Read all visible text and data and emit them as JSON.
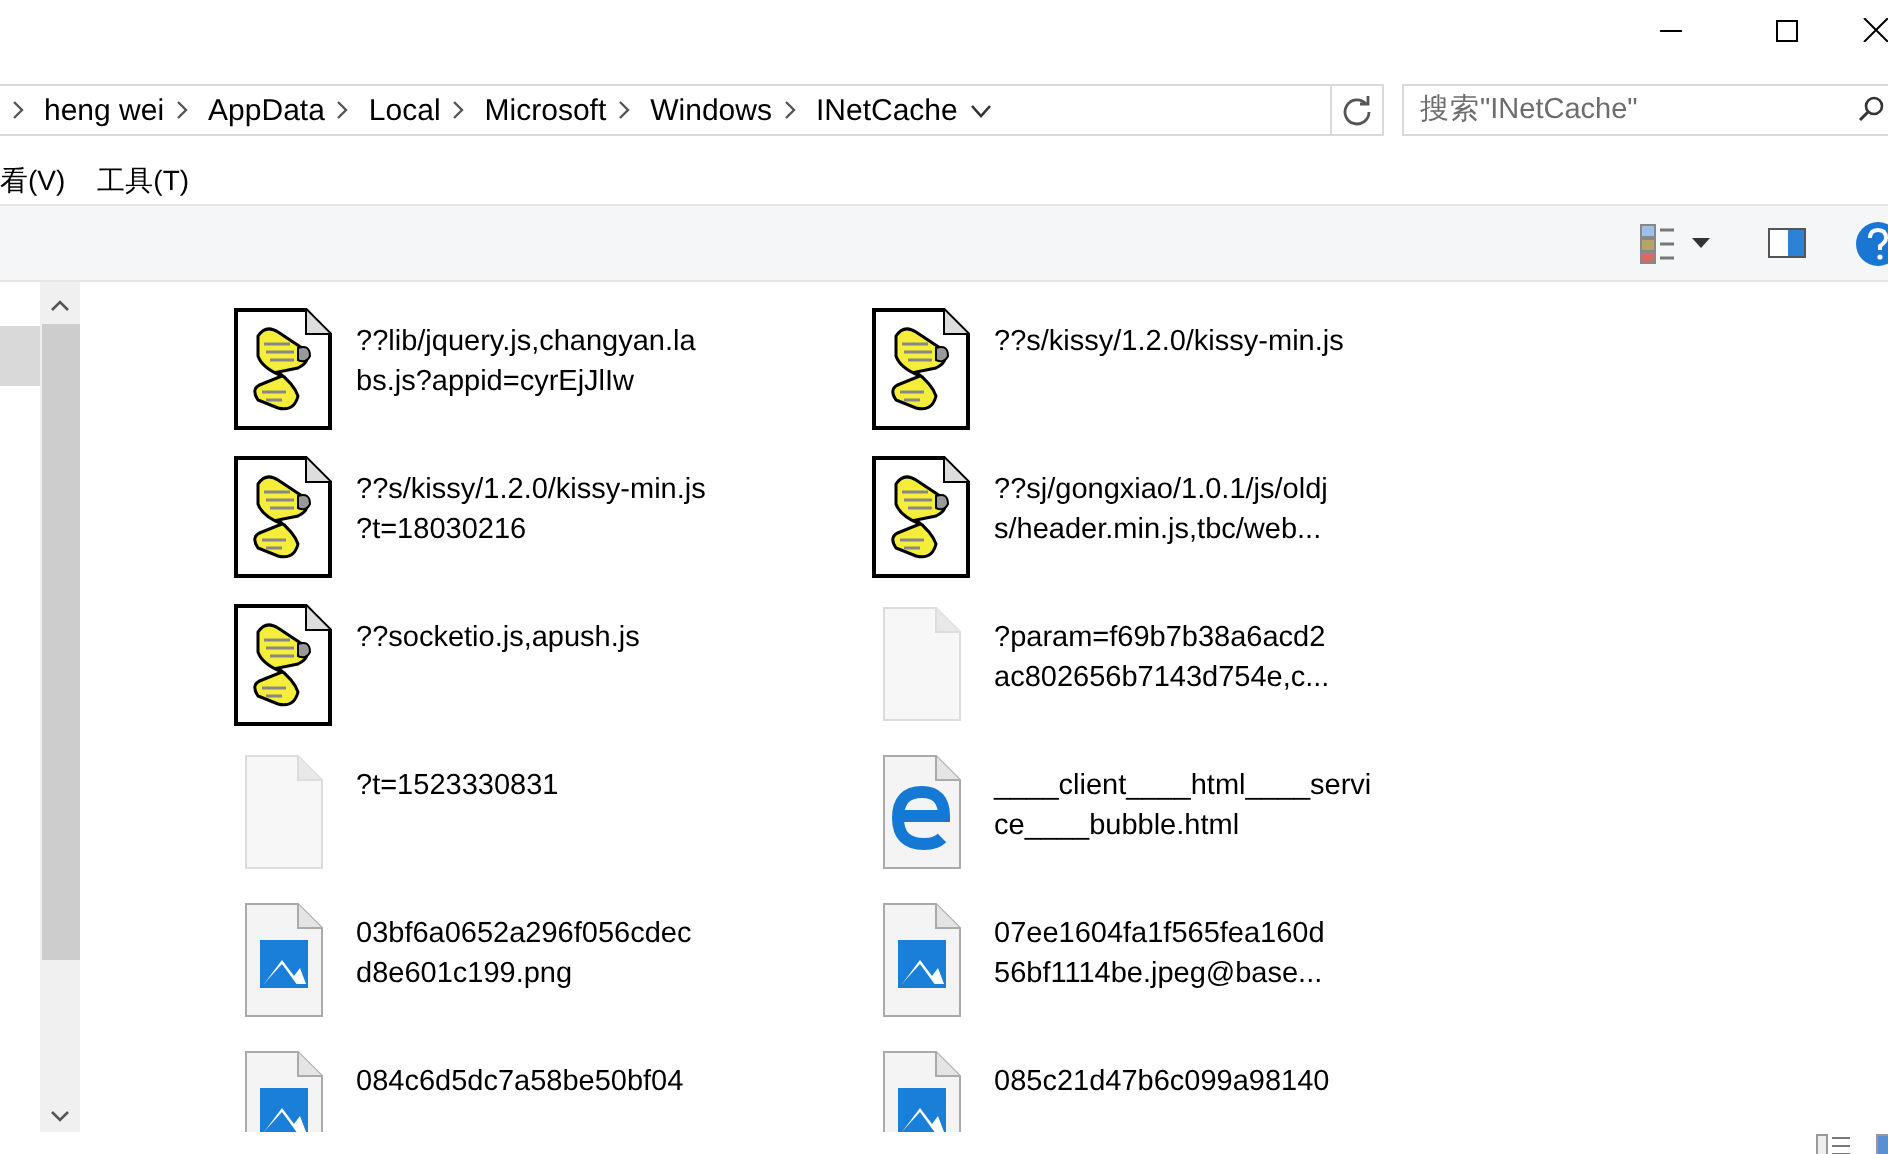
{
  "address_bar": {
    "breadcrumbs": [
      "heng wei",
      "AppData",
      "Local",
      "Microsoft",
      "Windows",
      "INetCache"
    ]
  },
  "search": {
    "placeholder": "搜索\"INetCache\""
  },
  "menu_bar": [
    "看(V)",
    "工具(T)"
  ],
  "files": [
    {
      "kind": "script",
      "lines": [
        "??lib/jquery.js,changyan.la",
        "bs.js?appid=cyrEjJlIw"
      ]
    },
    {
      "kind": "script",
      "lines": [
        "??s/kissy/1.2.0/kissy-min.js"
      ]
    },
    {
      "kind": "script",
      "lines": [
        "??s/kissy/1.2.0/kissy-min.js",
        "?t=18030216"
      ]
    },
    {
      "kind": "script",
      "lines": [
        "??sj/gongxiao/1.0.1/js/oldj",
        "s/header.min.js,tbc/web..."
      ]
    },
    {
      "kind": "script",
      "lines": [
        "??socketio.js,apush.js"
      ]
    },
    {
      "kind": "blank",
      "lines": [
        "?param=f69b7b38a6acd2",
        "ac802656b7143d754e,c..."
      ]
    },
    {
      "kind": "blank",
      "lines": [
        "?t=1523330831"
      ]
    },
    {
      "kind": "edge",
      "lines": [
        "____client____html____servi",
        "ce____bubble.html"
      ]
    },
    {
      "kind": "image",
      "lines": [
        "03bf6a0652a296f056cdec",
        "d8e601c199.png"
      ]
    },
    {
      "kind": "image",
      "lines": [
        "07ee1604fa1f565fea160d",
        "56bf1114be.jpeg@base..."
      ]
    },
    {
      "kind": "image",
      "lines": [
        "084c6d5dc7a58be50bf04"
      ]
    },
    {
      "kind": "image",
      "lines": [
        "085c21d47b6c099a98140"
      ]
    }
  ]
}
